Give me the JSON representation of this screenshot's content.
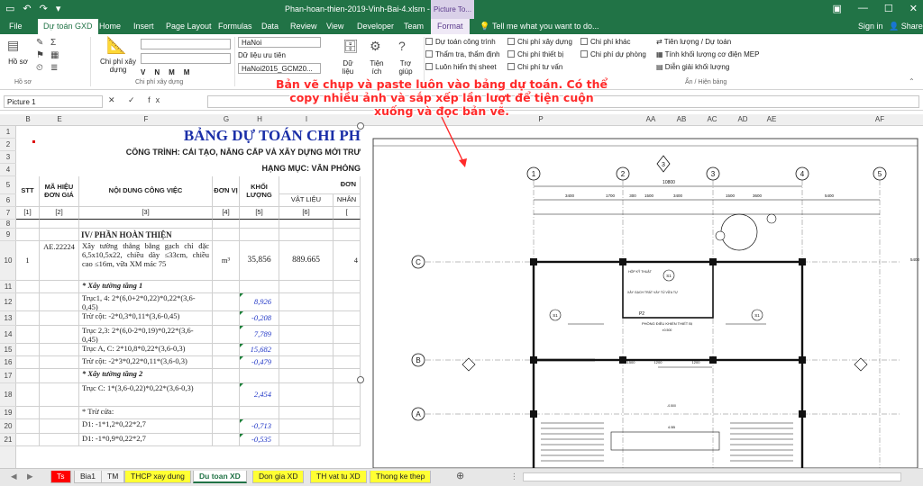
{
  "window": {
    "filename": "Phan-hoan-thien-2019-Vinh-Bai-4.xlsm - Excel",
    "context_tab": "Picture To...",
    "search": "Tell me what you want to do...",
    "signin": "Sign in",
    "share": "Share"
  },
  "tabs": [
    "File",
    "Dự toán GXD",
    "Home",
    "Insert",
    "Page Layout",
    "Formulas",
    "Data",
    "Review",
    "View",
    "Developer",
    "Team",
    "Format"
  ],
  "ribbon": {
    "ho_so": "Hồ sơ",
    "chi_phi_xay_dung": "Chi phí xây dựng",
    "region": "HaNoi",
    "du_lieu_uu_tien": "Dữ liệu ưu tiên",
    "dataset": "HaNoi2015_GCM20...",
    "format_letters": [
      "V",
      "N",
      "M",
      "M"
    ],
    "du_lieu": "Dữ liệu",
    "tien_ich": "Tiện ích",
    "tro_giup": "Trợ giúp",
    "chk1": [
      "Dự toán công trình",
      "Thẩm tra, thẩm định",
      "Luôn hiển thị sheet"
    ],
    "chk2": [
      "Chi phí xây dựng",
      "Chi phí thiết bị",
      "Chi phí tư vấn"
    ],
    "chk3": [
      "Chi phí khác",
      "Chi phí dự phòng"
    ],
    "right": [
      "Tiên lượng / Dự toán",
      "Tính khối lượng cơ điện MEP",
      "Diễn giải khối lượng"
    ],
    "group_label": "Ẩn / Hiện bảng"
  },
  "formula": {
    "namebox": "Picture 1",
    "fx": "✕ ✓ fx"
  },
  "columns": [
    "B",
    "E",
    "F",
    "G",
    "H",
    "I",
    "P",
    "AA",
    "AB",
    "AC",
    "AD",
    "AE",
    "AF"
  ],
  "rows": [
    "1",
    "2",
    "3",
    "4",
    "5",
    "6",
    "7",
    "8",
    "9",
    "10",
    "11",
    "12",
    "13",
    "14",
    "15",
    "16",
    "17",
    "18",
    "19",
    "20",
    "21"
  ],
  "sheet": {
    "title": "BẢNG DỰ TOÁN CHI PH",
    "cong_trinh": "CÔNG TRÌNH: CẢI TẠO, NÂNG CẤP VÀ XÂY DỰNG MỚI TRƯ",
    "hang_muc": "HẠNG MỤC: VĂN PHÒNG",
    "hdr": {
      "stt": "STT",
      "ma_hieu": "MÃ HIỆU ĐƠN GIÁ",
      "noi_dung": "NỘI DUNG CÔNG VIỆC",
      "don_vi": "ĐƠN VỊ",
      "khoi_luong": "KHỐI LƯỢNG",
      "don_gia": "ĐƠN",
      "vat_lieu": "VẬT LIỆU",
      "nhan": "NHÂN"
    },
    "idx": [
      "[1]",
      "[2]",
      "[3]",
      "[4]",
      "[5]",
      "[6]",
      "["
    ],
    "section": "IV/ PHẦN HOÀN THIỆN",
    "item": {
      "stt": "1",
      "code": "AE.22224",
      "desc": "Xây tường thẳng bằng gạch chỉ đặc 6,5x10,5x22, chiều dày ≤33cm, chiều cao ≤16m, vữa XM mác 75",
      "unit": "m³",
      "qty": "35,856",
      "vl": "889.665",
      "nc": "4"
    },
    "lines": [
      {
        "t": "* Xây tường tầng 1",
        "v": "",
        "i": true
      },
      {
        "t": "Trục1, 4: 2*(6,0+2*0,22)*0,22*(3,6-0,45)",
        "v": "8,926"
      },
      {
        "t": "Trừ cột: -2*0,3*0,11*(3,6-0,45)",
        "v": "-0,208"
      },
      {
        "t": "Trục 2,3: 2*(6,0-2*0,19)*0,22*(3,6-0,45)",
        "v": "7,789"
      },
      {
        "t": "Trục A, C: 2*10,8*0,22*(3,6-0,3)",
        "v": "15,682"
      },
      {
        "t": "Trừ cột: -2*3*0,22*0,11*(3,6-0,3)",
        "v": "-0,479"
      },
      {
        "t": "* Xây tường tầng 2",
        "v": "",
        "i": true
      },
      {
        "t": "Trục C: 1*(3,6-0,22)*0,22*(3,6-0,3)",
        "v": "2,454"
      },
      {
        "t": "* Trừ cửa:",
        "v": ""
      },
      {
        "t": "D1: -1*1,2*0,22*2,7",
        "v": "-0,713"
      },
      {
        "t": "D1: -1*0,9*0,22*2,7",
        "v": "-0,535"
      }
    ]
  },
  "annotation": "Bản vẽ chụp và paste luôn vào bảng dự toán. Có thể copy nhiều ảnh và sắp xếp lần lượt để tiện cuộn xuống và đọc bản vẽ.",
  "drawing": {
    "axes_top": [
      "1",
      "2",
      "3",
      "4",
      "5"
    ],
    "axes_left": [
      "C",
      "B",
      "A"
    ],
    "dims": [
      "10800",
      "3400",
      "1700",
      "300",
      "1500",
      "3400",
      "1500",
      "3600",
      "5400",
      "1500",
      "1200",
      "1200"
    ],
    "labels": [
      "S1",
      "S1",
      "S1",
      "P2",
      "HỘP KỸ THUẬT",
      "XÂY GẠCH TRÁT VÁY TỦ VỮA TỰ",
      "PHÒNG ĐIỀU KHIỂN THIẾT BỊ",
      "±0.500",
      "-0.500",
      "4.5B"
    ]
  },
  "sheet_tabs": [
    "Ts",
    "Bia1",
    "TM",
    "THCP xay dung",
    "Du toan XD",
    "Don gia XD",
    "TH vat tu XD",
    "Thong ke thep"
  ],
  "colors": {
    "excel_green": "#217346",
    "highlight_yellow": "#ffff33",
    "red_tab": "#ff0000",
    "annotation_red": "#ff2a2a",
    "qty_blue": "#1f35c6"
  }
}
